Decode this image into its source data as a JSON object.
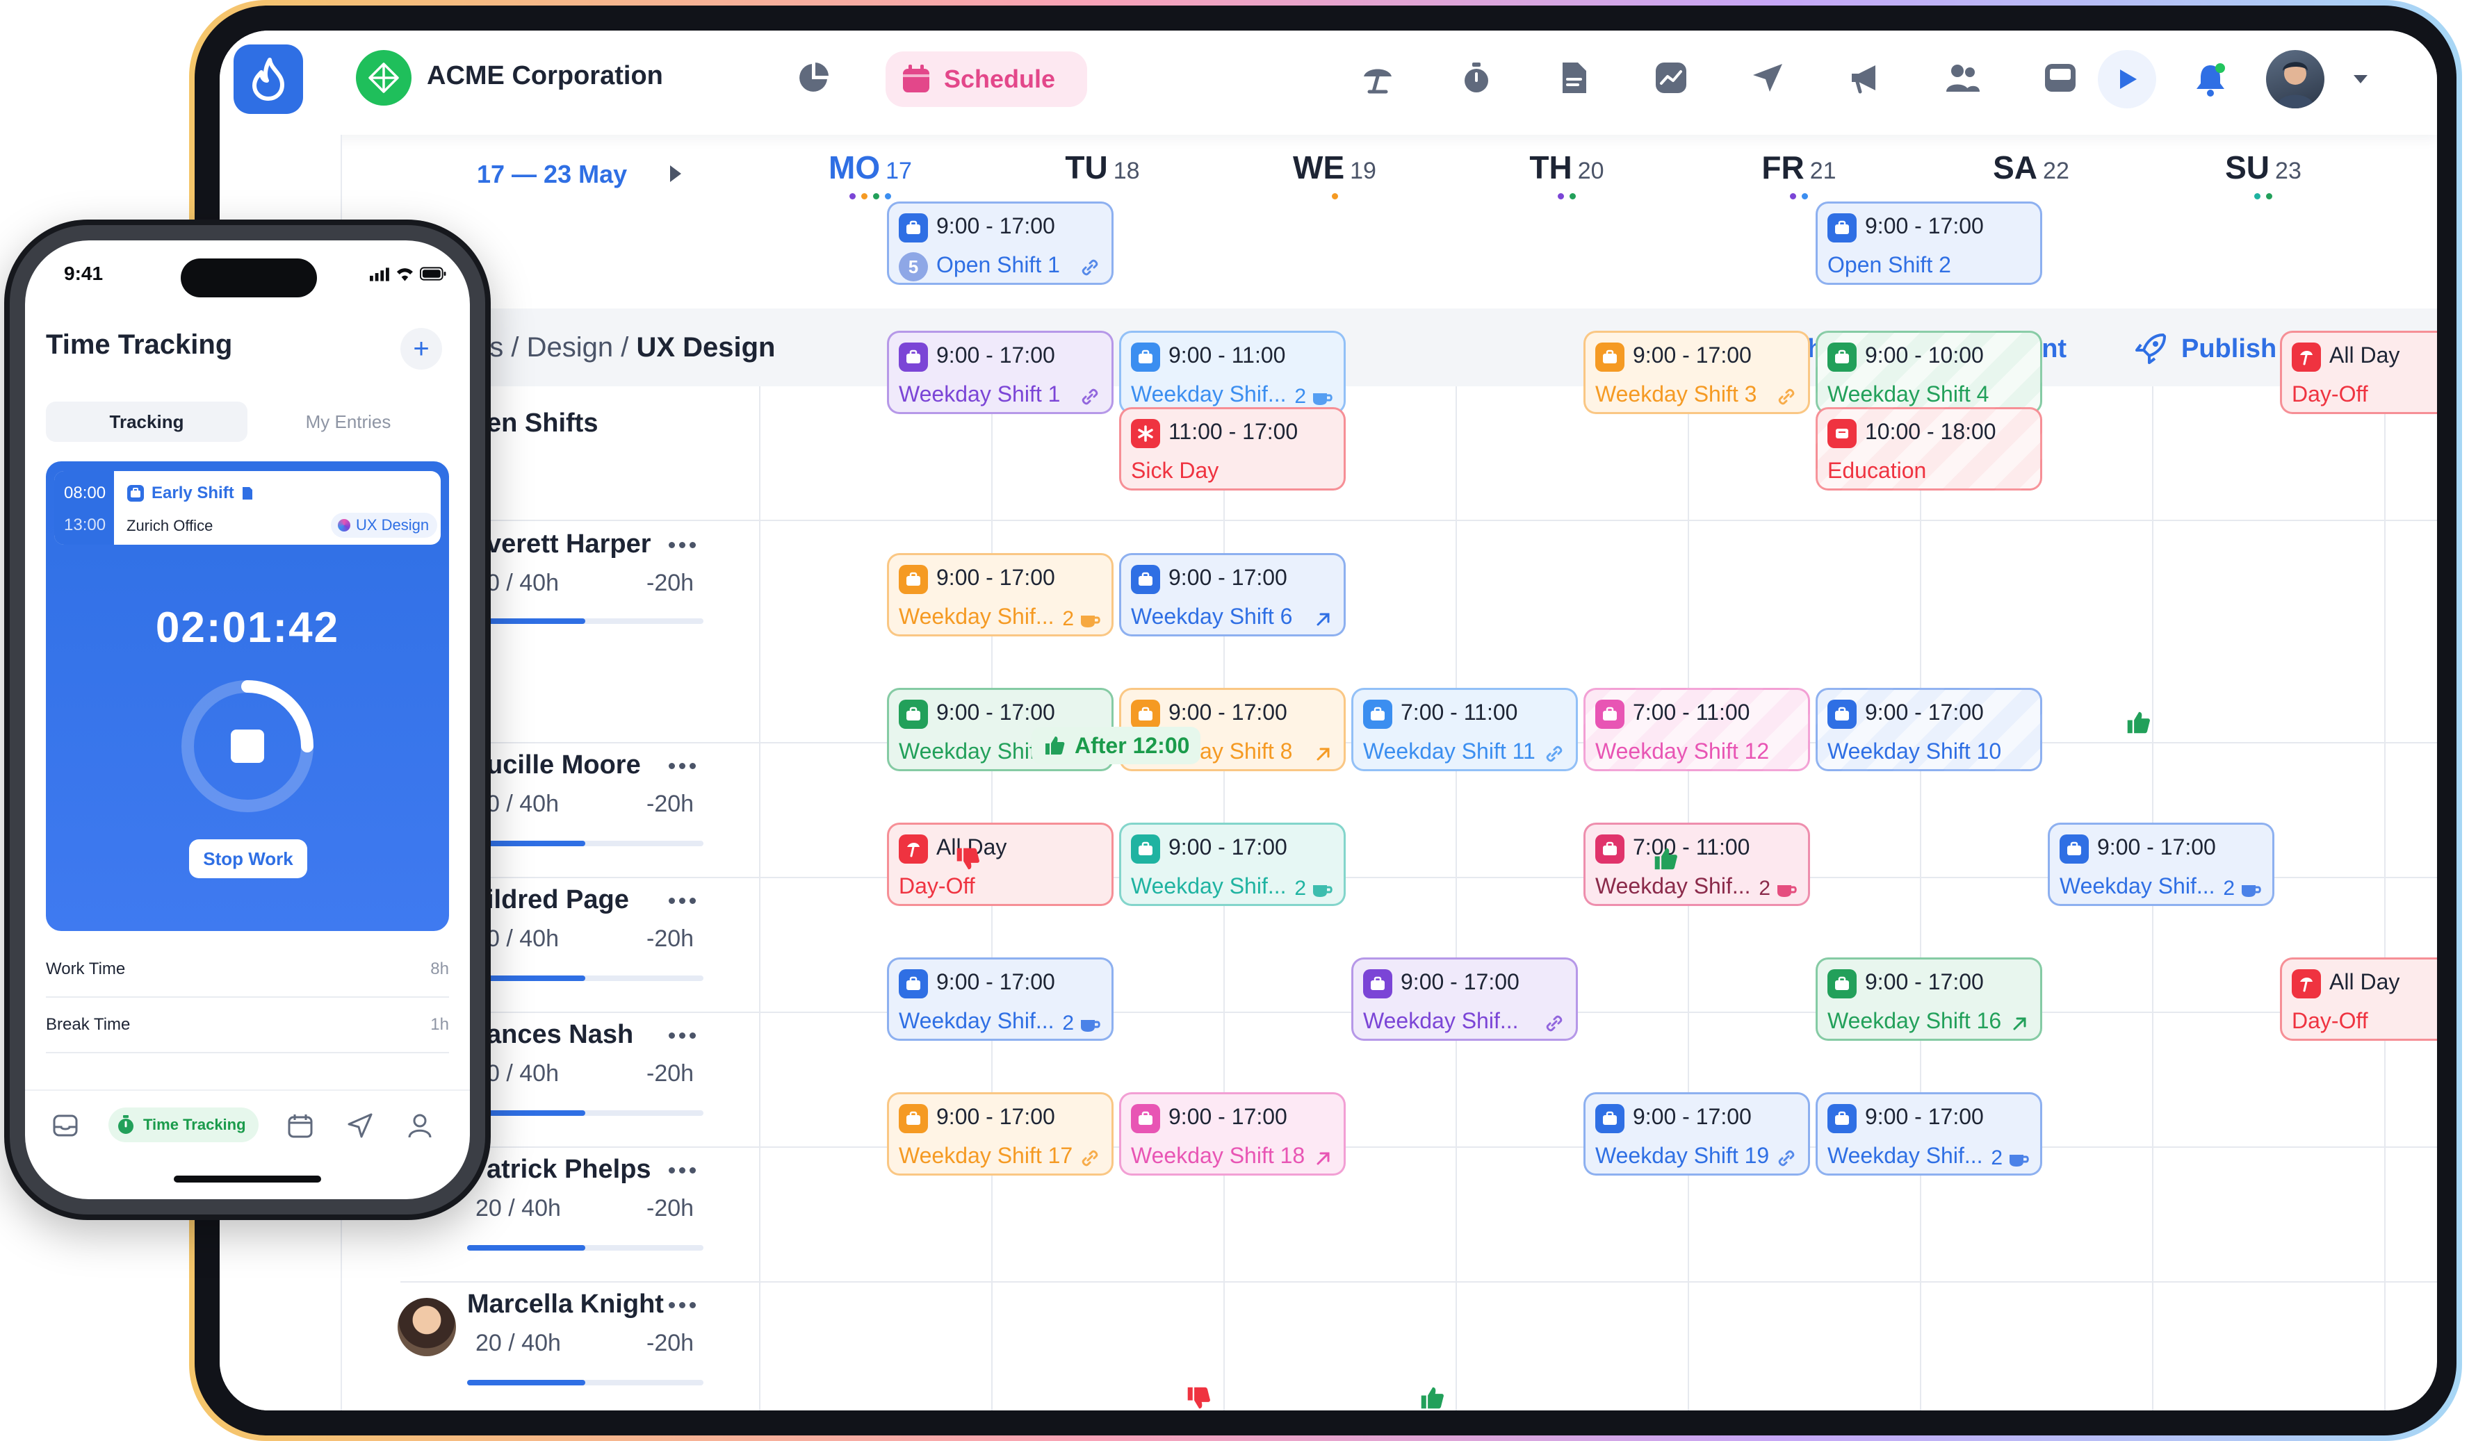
{
  "header": {
    "org_name": "ACME Corporation",
    "active_nav": "Schedule",
    "nav_icons": [
      "dashboard-icon",
      "schedule-icon",
      "absence-icon",
      "time-tracking-icon",
      "document-icon",
      "reports-icon",
      "messages-icon",
      "announcements-icon",
      "employees-icon",
      "inbox-icon"
    ]
  },
  "week": {
    "range": "17 — 23 May",
    "days": [
      {
        "name": "MO",
        "date": "17"
      },
      {
        "name": "TU",
        "date": "18"
      },
      {
        "name": "WE",
        "date": "19"
      },
      {
        "name": "TH",
        "date": "20"
      },
      {
        "name": "FR",
        "date": "21"
      },
      {
        "name": "SA",
        "date": "22"
      },
      {
        "name": "SU",
        "date": "23"
      }
    ]
  },
  "toolbar": {
    "breadcrumb_prefix": "as / Design / ",
    "breadcrumb_current": "UX Design",
    "flash": "Flash",
    "assistant": "Assistant",
    "publish": "Publish"
  },
  "rows": [
    {
      "name": "en Shifts"
    },
    {
      "name": "verett Harper",
      "hours": "0  /  40h",
      "diff": "-20h",
      "progress": 0.5
    },
    {
      "name": "ucille Moore",
      "hours": "0  /  40h",
      "diff": "-20h",
      "progress": 0.5
    },
    {
      "name": "ildred Page",
      "hours": "0  /  40h",
      "diff": "-20h",
      "progress": 0.5
    },
    {
      "name": "ances Nash",
      "hours": "0  /  40h",
      "diff": "-20h",
      "progress": 0.5
    },
    {
      "name": "atrick Phelps",
      "hours": "20  /  40h",
      "diff": "-20h",
      "progress": 0.5
    },
    {
      "name": "Marcella Knight",
      "hours": "20  /  40h",
      "diff": "-20h",
      "progress": 0.5
    }
  ],
  "shifts": {
    "s0": {
      "time": "9:00 - 17:00",
      "label": "Open Shift 1",
      "num": "5"
    },
    "s1": {
      "time": "9:00 - 17:00",
      "label": "Open Shift 2"
    },
    "s2": {
      "time": "9:00 - 17:00",
      "label": "Weekday Shift 1"
    },
    "s3": {
      "time": "9:00 - 11:00",
      "label": "Weekday Shif...",
      "count": "2"
    },
    "s4": {
      "time": "11:00 - 17:00",
      "label": "Sick Day"
    },
    "s5": {
      "time": "9:00 - 17:00",
      "label": "Weekday Shift 3"
    },
    "s6": {
      "time": "9:00 - 10:00",
      "label": "Weekday Shift 4"
    },
    "s7": {
      "time": "10:00 - 18:00",
      "label": "Education"
    },
    "s8": {
      "time": "All Day",
      "label": "Day-Off"
    },
    "s9": {
      "time": "9:00 - 17:00",
      "label": "Weekday Shif...",
      "count": "2"
    },
    "s10": {
      "time": "9:00 - 17:00",
      "label": "Weekday Shift 6"
    },
    "s11": {
      "time": "9:00 - 17:00",
      "label": "Weekday Shif...",
      "count": "2"
    },
    "s12": {
      "time": "9:00 - 17:00",
      "label": "Weekday Shift 8"
    },
    "s13": {
      "time": "7:00 - 11:00",
      "label": "Weekday Shift 11"
    },
    "s14": {
      "time": "7:00 - 11:00",
      "label": "Weekday Shift 12"
    },
    "s15": {
      "time": "9:00 - 17:00",
      "label": "Weekday Shift 10"
    },
    "s16": {
      "time": "All Day",
      "label": "Day-Off"
    },
    "s17": {
      "time": "9:00 - 17:00",
      "label": "Weekday Shif...",
      "count": "2"
    },
    "s18": {
      "time": "7:00 - 11:00",
      "label": "Weekday Shif...",
      "count": "2"
    },
    "s19": {
      "time": "9:00 - 17:00",
      "label": "Weekday Shif...",
      "count": "2"
    },
    "s20": {
      "time": "9:00 - 17:00",
      "label": "Weekday Shif...",
      "count": "2"
    },
    "s21": {
      "time": "9:00 - 17:00",
      "label": "Weekday Shif..."
    },
    "s22": {
      "time": "9:00 - 17:00",
      "label": "Weekday Shift 16"
    },
    "s23": {
      "time": "All Day",
      "label": "Day-Off"
    },
    "s24": {
      "time": "9:00 - 17:00",
      "label": "Weekday Shift 17"
    },
    "s25": {
      "time": "9:00 - 17:00",
      "label": "Weekday Shift 18"
    },
    "s26": {
      "time": "9:00 - 17:00",
      "label": "Weekday Shift 19"
    },
    "s27": {
      "time": "9:00 - 17:00",
      "label": "Weekday Shif...",
      "count": "2"
    }
  },
  "after_badge": "After 12:00",
  "colors": {
    "blue": "#2f6fe4",
    "purple": "#7b45d6",
    "orange": "#f59a23",
    "green": "#22a05a",
    "red": "#ef3340",
    "pink": "#e855b4",
    "teal": "#1fb3a1",
    "crimson": "#e0336b",
    "sky": "#3b8ef0"
  },
  "phone": {
    "status_time": "9:41",
    "title": "Time Tracking",
    "tab_tracking": "Tracking",
    "tab_entries": "My Entries",
    "shift_start": "08:00",
    "shift_end": "13:00",
    "shift_name": "Early Shift",
    "shift_location": "Zurich Office",
    "shift_tag": "UX Design",
    "timer": "02:01:42",
    "stop": "Stop Work",
    "work_time_label": "Work Time",
    "work_time_value": "8h",
    "break_time_label": "Break Time",
    "break_time_value": "1h",
    "nav_active": "Time Tracking"
  }
}
